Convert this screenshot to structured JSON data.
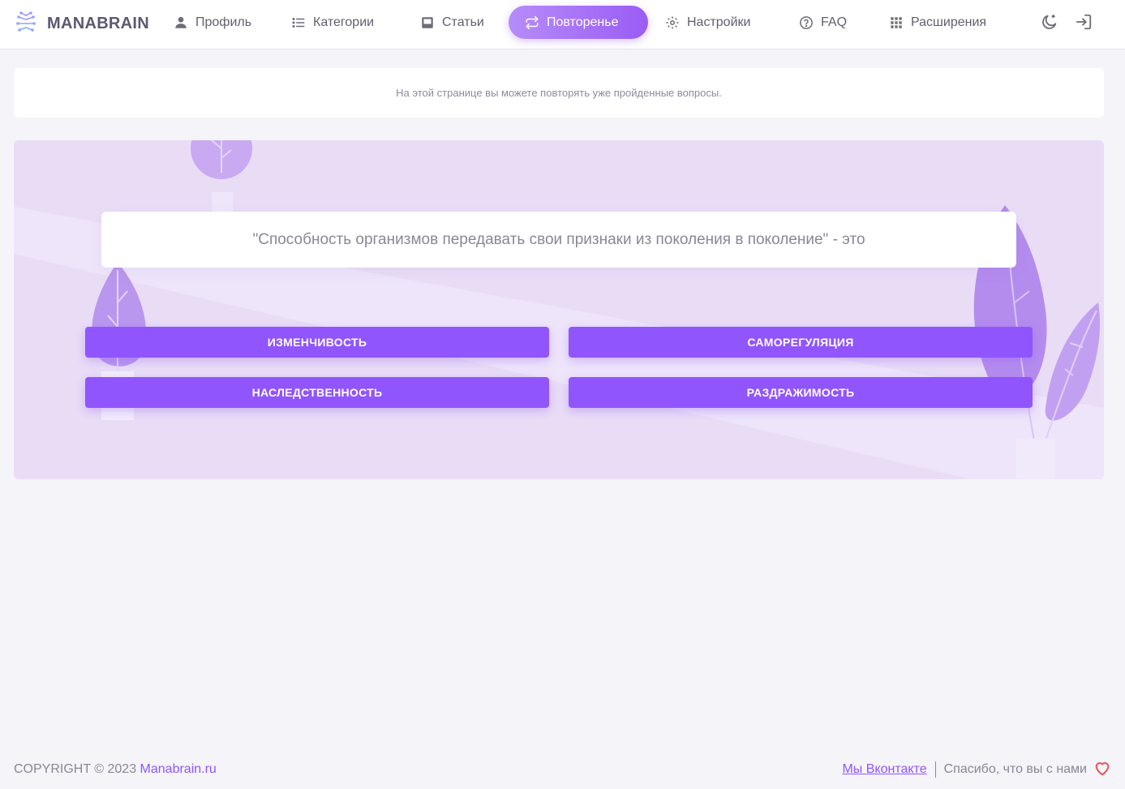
{
  "brand": {
    "name": "MANABRAIN",
    "accent": "#9155fd"
  },
  "nav": {
    "items": [
      {
        "label": "Профиль",
        "icon": "user-icon",
        "active": false
      },
      {
        "label": "Категории",
        "icon": "list-icon",
        "active": false
      },
      {
        "label": "Статьи",
        "icon": "article-icon",
        "active": false
      },
      {
        "label": "Повторенье",
        "icon": "repeat-icon",
        "active": true
      },
      {
        "label": "Настройки",
        "icon": "gear-icon",
        "active": false
      },
      {
        "label": "FAQ",
        "icon": "help-circle-icon",
        "active": false
      },
      {
        "label": "Расширения",
        "icon": "grid-icon",
        "active": false
      }
    ],
    "theme_toggle_icon": "moon-icon",
    "logout_icon": "logout-icon"
  },
  "info": {
    "text": "На этой странице вы можете повторять уже пройденные вопросы."
  },
  "quiz": {
    "question": "\"Способность организмов передавать свои признаки из поколения в поколение\" - это",
    "answers": [
      "ИЗМЕНЧИВОСТЬ",
      "САМОРЕГУЛЯЦИЯ",
      "НАСЛЕДСТВЕННОСТЬ",
      "РАЗДРАЖИМОСТЬ"
    ]
  },
  "footer": {
    "copyright": "COPYRIGHT © 2023 ",
    "site": "Manabrain.ru",
    "vk_link": "Мы Вконтакте",
    "thanks": "Спасибо, что вы с нами",
    "heart_icon": "heart-icon",
    "heart_color": "#ea5455"
  }
}
